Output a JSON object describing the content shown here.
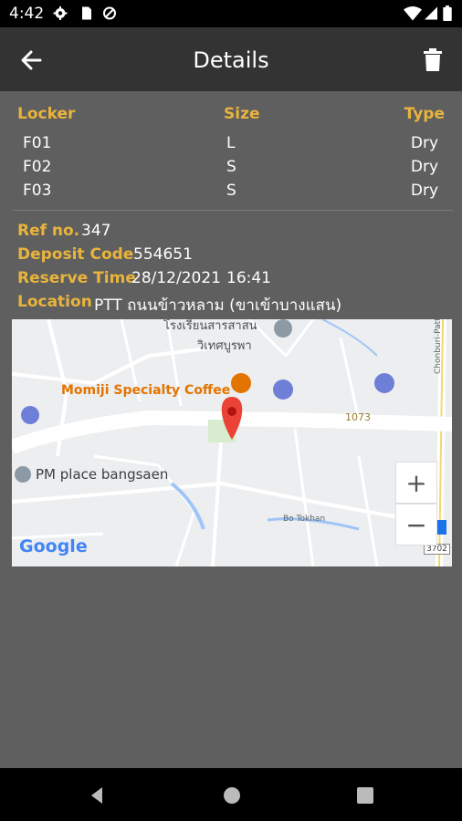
{
  "status_bar": {
    "time": "4:42"
  },
  "header": {
    "title": "Details"
  },
  "table": {
    "columns": [
      "Locker",
      "Size",
      "Type"
    ],
    "rows": [
      {
        "locker": "F01",
        "size": "L",
        "type": "Dry"
      },
      {
        "locker": "F02",
        "size": "S",
        "type": "Dry"
      },
      {
        "locker": "F03",
        "size": "S",
        "type": "Dry"
      }
    ]
  },
  "details": {
    "ref_label": "Ref no.",
    "ref_value": "347",
    "deposit_label": "Deposit Code",
    "deposit_value": "554651",
    "reserve_label": "Reserve Time",
    "reserve_date": "28/12/2021",
    "reserve_time": "16:41",
    "location_label": "Location",
    "location_value": "PTT ถนนข้าวหลาม (ขาเข้าบางแสน)"
  },
  "map": {
    "labels": {
      "school_line1": "โรงเรียนสารสาสน",
      "school_line2": "วิเทศบูรพา",
      "cafe": "Momiji Specialty Coffee",
      "place": "PM place bangsaen",
      "road_number": "1073",
      "road_name": "Bo Tokhan",
      "highway": "Chonburi-Pattaya Hwy",
      "badge": "3702",
      "brand": "Google"
    },
    "zoom_in": "+",
    "zoom_out": "−",
    "colors": {
      "pin": "#ea4335",
      "cafe": "#e37400",
      "fuel": "#6f7fd8"
    }
  },
  "colors": {
    "accent": "#e9b43c",
    "background": "#5f5f5f",
    "appbar": "#333333"
  }
}
